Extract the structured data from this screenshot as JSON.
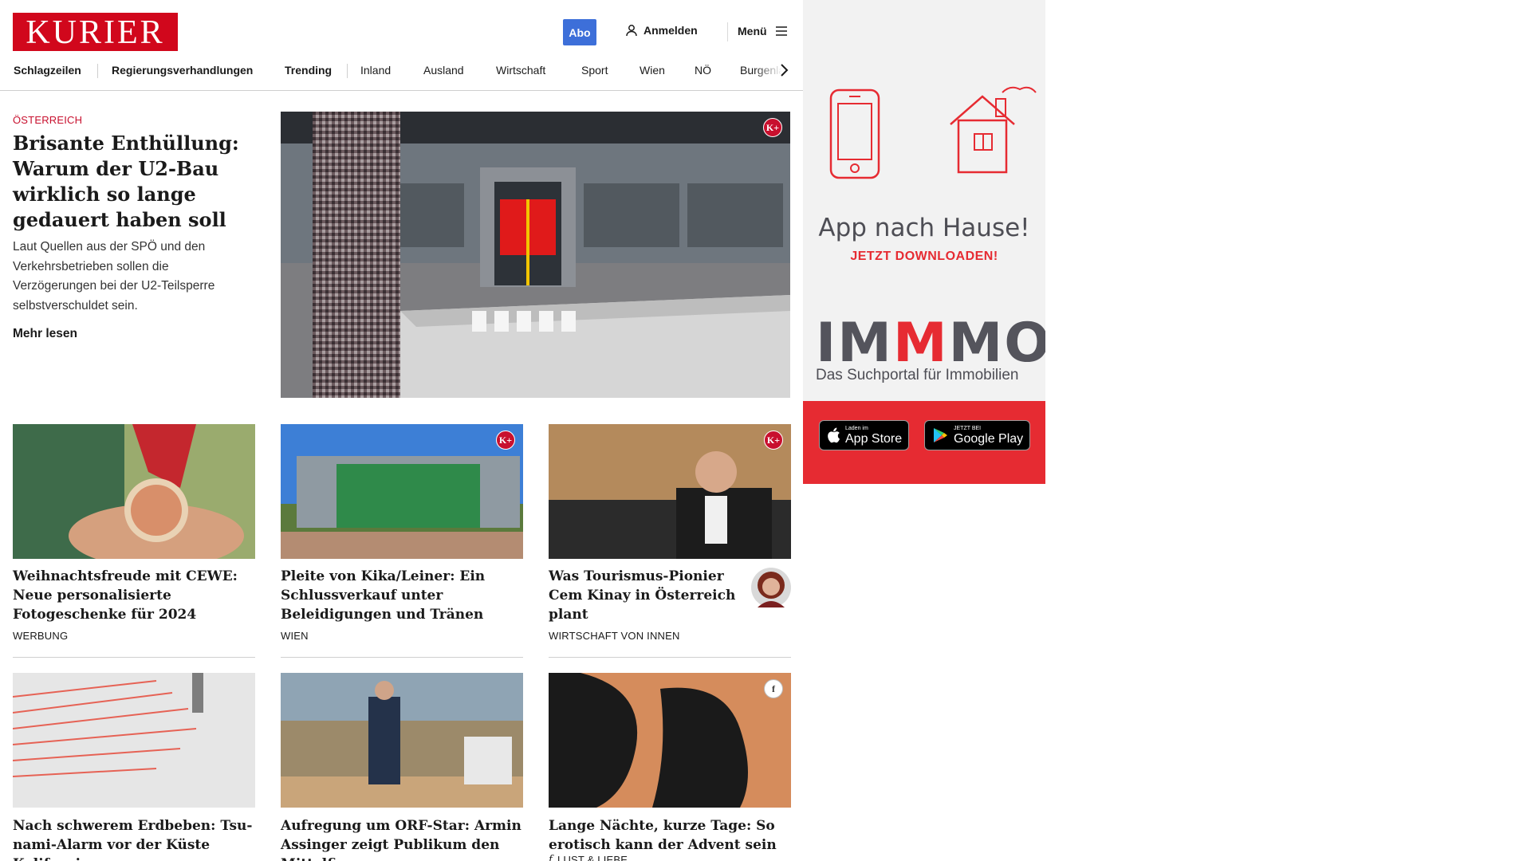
{
  "header": {
    "logo": "KURIER",
    "abo": "Abo",
    "login": "Anmelden",
    "menu": "Menü"
  },
  "nav": {
    "items": [
      "Schlagzeilen",
      "Regierungsverhandlungen",
      "Trending",
      "Inland",
      "Ausland",
      "Wirtschaft",
      "Sport",
      "Wien",
      "NÖ",
      "Burgenland"
    ]
  },
  "lead": {
    "kicker": "ÖSTERREICH",
    "title": "Brisante Enthüllung: Warum der U2-Bau wirk­lich so lange gedauert ha­ben soll",
    "teaser": "Laut Quellen aus der SPÖ und den Verkehrsbetrieben sollen die Verzögerungen bei der U2-Teilsperre selbstverschuldet sein.",
    "more": "Mehr lesen",
    "premium": "K+"
  },
  "cards": [
    {
      "title": "Weihnachtsfreude mit CEWE: Neue personalisierte Fotogeschenke für 2024",
      "tag": "WERBUNG"
    },
    {
      "title": "Pleite von Kika/Leiner: Ein Schlussverkauf unter Beleidigun­gen und Tränen",
      "tag": "WIEN",
      "premium": "K+"
    },
    {
      "title": "Was Tourismus-Pionier Cem Kinay in Österreich plant",
      "tag": "WIRTSCHAFT VON INNEN",
      "premium": "K+"
    },
    {
      "title": "Nach schwerem Erdbeben: Tsu­nami-Alarm vor der Küste Kaliforniens",
      "tag": ""
    },
    {
      "title": "Aufregung um ORF-Star: Armin Assinger zeigt Publikum den Mittelfinger",
      "tag": ""
    },
    {
      "title": "Lange Nächte, kurze Tage: So ero­tisch kann der Advent sein",
      "tag": "LUST & LIEBE",
      "premium": "f"
    }
  ],
  "ad": {
    "headline": "App nach Hause!",
    "sub": "JETZT DOWNLOADEN!",
    "brand_a": "IM",
    "brand_b": "M",
    "brand_c": "MO",
    "brand_sub": "Das Suchportal für Immobilien",
    "appstore_small": "Laden im",
    "appstore_big": "App Store",
    "gplay_small": "JETZT BEI",
    "gplay_big": "Google Play"
  },
  "colors": {
    "brand": "#d1071c",
    "abo": "#3d6fd9",
    "ad_red": "#e62b32"
  }
}
